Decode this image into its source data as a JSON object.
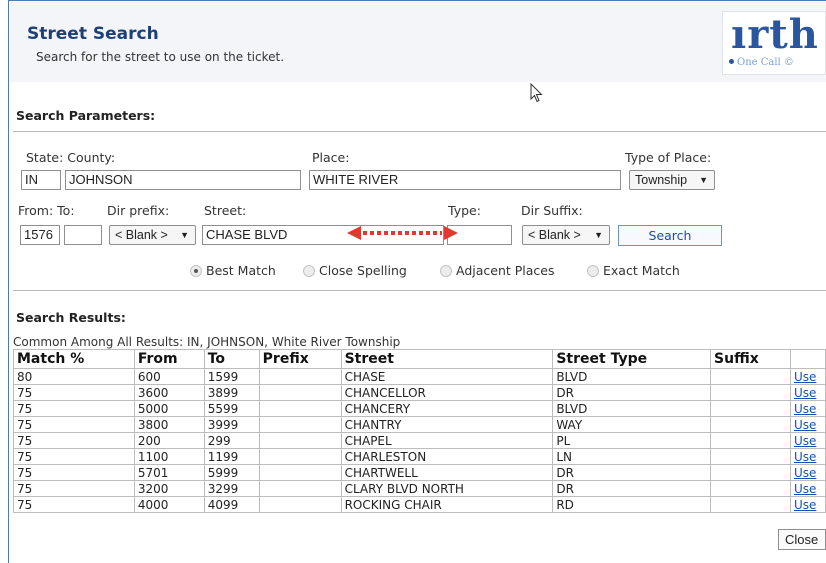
{
  "header": {
    "title": "Street Search",
    "subtitle": "Search for the street to use on the ticket.",
    "logo_text": "ırth",
    "logo_sub": "One Call ©"
  },
  "params": {
    "section_label": "Search Parameters:",
    "state_county_label": "State: County:",
    "place_label": "Place:",
    "type_of_place_label": "Type of Place:",
    "state_value": "IN",
    "county_value": "JOHNSON",
    "place_value": "WHITE RIVER",
    "type_of_place_value": "Township",
    "from_to_label": "From: To:",
    "dir_prefix_label": "Dir prefix:",
    "street_label": "Street:",
    "type_label": "Type:",
    "dir_suffix_label": "Dir Suffix:",
    "from_value": "1576",
    "to_value": "",
    "dir_prefix_value": "< Blank >",
    "street_value": "CHASE BLVD",
    "type_value": "",
    "dir_suffix_value": "< Blank >",
    "search_button": "Search",
    "select_arrow": "▼"
  },
  "match_options": [
    {
      "label": "Best Match",
      "selected": true
    },
    {
      "label": "Close Spelling",
      "selected": false
    },
    {
      "label": "Adjacent Places",
      "selected": false
    },
    {
      "label": "Exact Match",
      "selected": false
    }
  ],
  "results": {
    "section_label": "Search Results:",
    "common_text": "Common Among All Results: IN, JOHNSON, White River Township",
    "columns": [
      "Match %",
      "From",
      "To",
      "Prefix",
      "Street",
      "Street Type",
      "Suffix",
      ""
    ],
    "rows": [
      {
        "match": "80",
        "from": "600",
        "to": "1599",
        "prefix": "",
        "street": "CHASE",
        "type": "BLVD",
        "suffix": "",
        "action": "Use"
      },
      {
        "match": "75",
        "from": "3600",
        "to": "3899",
        "prefix": "",
        "street": "CHANCELLOR",
        "type": "DR",
        "suffix": "",
        "action": "Use"
      },
      {
        "match": "75",
        "from": "5000",
        "to": "5599",
        "prefix": "",
        "street": "CHANCERY",
        "type": "BLVD",
        "suffix": "",
        "action": "Use"
      },
      {
        "match": "75",
        "from": "3800",
        "to": "3999",
        "prefix": "",
        "street": "CHANTRY",
        "type": "WAY",
        "suffix": "",
        "action": "Use"
      },
      {
        "match": "75",
        "from": "200",
        "to": "299",
        "prefix": "",
        "street": "CHAPEL",
        "type": "PL",
        "suffix": "",
        "action": "Use"
      },
      {
        "match": "75",
        "from": "1100",
        "to": "1199",
        "prefix": "",
        "street": "CHARLESTON",
        "type": "LN",
        "suffix": "",
        "action": "Use"
      },
      {
        "match": "75",
        "from": "5701",
        "to": "5999",
        "prefix": "",
        "street": "CHARTWELL",
        "type": "DR",
        "suffix": "",
        "action": "Use"
      },
      {
        "match": "75",
        "from": "3200",
        "to": "3299",
        "prefix": "",
        "street": "CLARY BLVD NORTH",
        "type": "DR",
        "suffix": "",
        "action": "Use"
      },
      {
        "match": "75",
        "from": "4000",
        "to": "4099",
        "prefix": "",
        "street": "ROCKING CHAIR",
        "type": "RD",
        "suffix": "",
        "action": "Use"
      }
    ]
  },
  "footer": {
    "close_button": "Close"
  },
  "colors": {
    "title": "#1f3f79",
    "header_bg": "#f3f5f8",
    "annotation_arrow": "#e03a2f",
    "link": "#1a4fb0"
  },
  "icons": {
    "cursor": "mouse-pointer-icon",
    "annotation": "double-arrow-annotation-icon"
  }
}
